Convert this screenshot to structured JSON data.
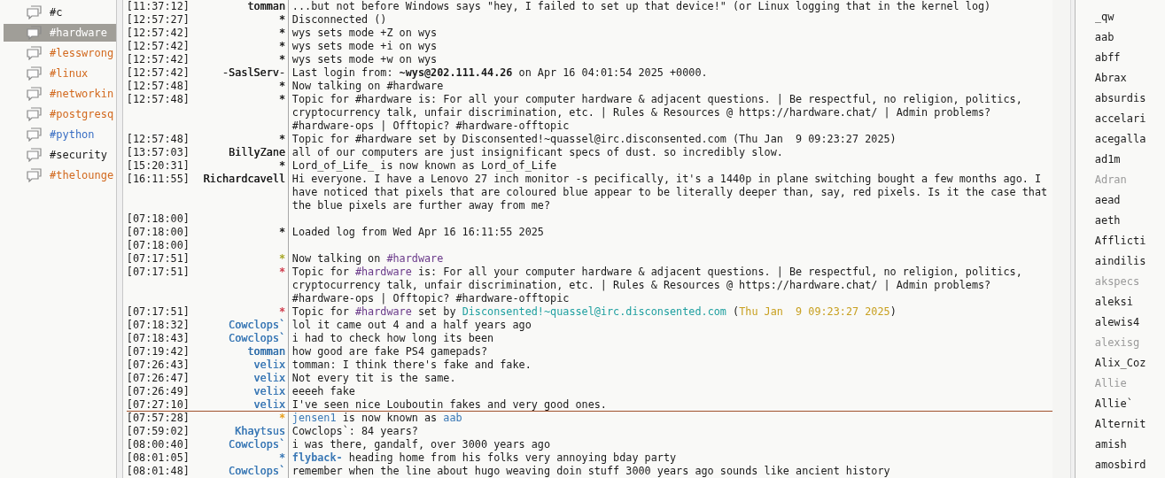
{
  "channels": [
    {
      "label": "#c",
      "color": "#1a1a1a",
      "selected": false
    },
    {
      "label": "#hardware",
      "color": "#ffffff",
      "selected": true
    },
    {
      "label": "#lesswrong",
      "color": "#d2691e",
      "selected": false
    },
    {
      "label": "#linux",
      "color": "#d2691e",
      "selected": false
    },
    {
      "label": "#networkin",
      "color": "#d2691e",
      "selected": false
    },
    {
      "label": "#postgresq",
      "color": "#d2691e",
      "selected": false
    },
    {
      "label": "#python",
      "color": "#3a6fc4",
      "selected": false
    },
    {
      "label": "#security",
      "color": "#1a1a1a",
      "selected": false
    },
    {
      "label": "#thelounge",
      "color": "#d2691e",
      "selected": false
    }
  ],
  "messages": [
    {
      "time": "[11:37:12]",
      "nick": "tomman",
      "color": "#1a1a1a",
      "marker": false,
      "segments": [
        {
          "kind": "plain",
          "text": "...but not before Windows says \"hey, I failed to set up that device!\" (or Linux logging that in the kernel log)"
        }
      ]
    },
    {
      "time": "[12:57:27]",
      "nick": "*",
      "color": "#1a1a1a",
      "marker": false,
      "segments": [
        {
          "kind": "plain",
          "text": "Disconnected ()"
        }
      ]
    },
    {
      "time": "[12:57:42]",
      "nick": "*",
      "color": "#1a1a1a",
      "marker": false,
      "segments": [
        {
          "kind": "plain",
          "text": "wys sets mode +Z on wys"
        }
      ]
    },
    {
      "time": "[12:57:42]",
      "nick": "*",
      "color": "#1a1a1a",
      "marker": false,
      "segments": [
        {
          "kind": "plain",
          "text": "wys sets mode +i on wys"
        }
      ]
    },
    {
      "time": "[12:57:42]",
      "nick": "*",
      "color": "#1a1a1a",
      "marker": false,
      "segments": [
        {
          "kind": "plain",
          "text": "wys sets mode +w on wys"
        }
      ]
    },
    {
      "time": "[12:57:42]",
      "nick": "-SaslServ-",
      "color": "#1a1a1a",
      "marker": false,
      "segments": [
        {
          "kind": "plain",
          "text": "Last login from: "
        },
        {
          "kind": "bold",
          "text": "~wys@202.111.44.26"
        },
        {
          "kind": "plain",
          "text": " on Apr 16 04:01:54 2025 +0000."
        }
      ]
    },
    {
      "time": "[12:57:48]",
      "nick": "*",
      "color": "#1a1a1a",
      "marker": false,
      "segments": [
        {
          "kind": "plain",
          "text": "Now talking on #hardware"
        }
      ]
    },
    {
      "time": "[12:57:48]",
      "nick": "*",
      "color": "#1a1a1a",
      "marker": false,
      "segments": [
        {
          "kind": "plain",
          "text": "Topic for #hardware is: For all your computer hardware & adjacent questions. | Be respectful, no religion, politics, cryptocurrency talk, unfair discrimination, etc. | Rules & Resources @ https://hardware.chat/ | Admin problems? #hardware-ops | Offtopic? #hardware-offtopic"
        }
      ]
    },
    {
      "time": "[12:57:48]",
      "nick": "*",
      "color": "#1a1a1a",
      "marker": false,
      "segments": [
        {
          "kind": "plain",
          "text": "Topic for #hardware set by Disconsented!~quassel@irc.disconsented.com (Thu Jan  9 09:23:27 2025)"
        }
      ]
    },
    {
      "time": "[13:57:03]",
      "nick": "BillyZane",
      "color": "#1a1a1a",
      "marker": false,
      "segments": [
        {
          "kind": "plain",
          "text": "all of our computers are just insignificant specs of dust. so incredibly slow."
        }
      ]
    },
    {
      "time": "[15:20:31]",
      "nick": "*",
      "color": "#1a1a1a",
      "marker": false,
      "segments": [
        {
          "kind": "plain",
          "text": "Lord_of_Life_ is now known as Lord_of_Life"
        }
      ]
    },
    {
      "time": "[16:11:55]",
      "nick": "Richardcavell",
      "color": "#1a1a1a",
      "marker": false,
      "segments": [
        {
          "kind": "plain",
          "text": "Hi everyone. I have a Lenovo 27 inch monitor -s pecifically, it's a 1440p in plane switching bought a few months ago. I have noticed that pixels that are coloured blue appear to be literally deeper than, say, red pixels. Is it the case that the blue pixels are further away from me?"
        }
      ]
    },
    {
      "time": "[07:18:00]",
      "marker": false
    },
    {
      "time": "[07:18:00]",
      "nick": "*",
      "color": "#1a1a1a",
      "marker": false,
      "segments": [
        {
          "kind": "plain",
          "text": "Loaded log from Wed Apr 16 16:11:55 2025"
        }
      ]
    },
    {
      "time": "[07:18:00]",
      "marker": false
    },
    {
      "time": "[07:17:51]",
      "nick": "*",
      "color": "#a8a82a",
      "marker": false,
      "segments": [
        {
          "kind": "plain",
          "text": "Now talking on "
        },
        {
          "kind": "channel",
          "text": "#hardware"
        }
      ]
    },
    {
      "time": "[07:17:51]",
      "nick": "*",
      "color": "#d04050",
      "marker": false,
      "segments": [
        {
          "kind": "plain",
          "text": "Topic for "
        },
        {
          "kind": "channel",
          "text": "#hardware"
        },
        {
          "kind": "plain",
          "text": " is: For all your computer hardware & adjacent questions. | Be respectful, no religion, politics, cryptocurrency talk, unfair discrimination, etc. | Rules & Resources @ https://hardware.chat/ | Admin problems? #hardware-ops | Offtopic? #hardware-offtopic"
        }
      ]
    },
    {
      "time": "[07:17:51]",
      "nick": "*",
      "color": "#d04050",
      "marker": false,
      "segments": [
        {
          "kind": "plain",
          "text": "Topic for "
        },
        {
          "kind": "channel",
          "text": "#hardware"
        },
        {
          "kind": "plain",
          "text": " set by "
        },
        {
          "kind": "host",
          "text": "Disconsented!~quassel@irc.disconsented.com"
        },
        {
          "kind": "plain",
          "text": " ("
        },
        {
          "kind": "date",
          "text": "Thu Jan  9 09:23:27 2025"
        },
        {
          "kind": "plain",
          "text": ")"
        }
      ]
    },
    {
      "time": "[07:18:32]",
      "nick": "Cowclops`",
      "color": "#3a78b5",
      "marker": false,
      "segments": [
        {
          "kind": "plain",
          "text": "lol it came out 4 and a half years ago"
        }
      ]
    },
    {
      "time": "[07:18:43]",
      "nick": "Cowclops`",
      "color": "#3a78b5",
      "marker": false,
      "segments": [
        {
          "kind": "plain",
          "text": "i had to check how long its been"
        }
      ]
    },
    {
      "time": "[07:19:42]",
      "nick": "tomman",
      "color": "#2a6aa8",
      "marker": false,
      "segments": [
        {
          "kind": "plain",
          "text": "how good are fake PS4 gamepads?"
        }
      ]
    },
    {
      "time": "[07:26:43]",
      "nick": "velix",
      "color": "#3a78b5",
      "marker": false,
      "segments": [
        {
          "kind": "plain",
          "text": "tomman: I think there's fake and fake."
        }
      ]
    },
    {
      "time": "[07:26:47]",
      "nick": "velix",
      "color": "#3a78b5",
      "marker": false,
      "segments": [
        {
          "kind": "plain",
          "text": "Not every tit is the same."
        }
      ]
    },
    {
      "time": "[07:26:49]",
      "nick": "velix",
      "color": "#3a78b5",
      "marker": false,
      "segments": [
        {
          "kind": "plain",
          "text": "eeeeh fake"
        }
      ]
    },
    {
      "time": "[07:27:10]",
      "nick": "velix",
      "color": "#3a78b5",
      "marker": true,
      "segments": [
        {
          "kind": "plain",
          "text": "I've seen nice Louboutin fakes and very good ones."
        }
      ]
    },
    {
      "time": "[07:57:28]",
      "nick": "*",
      "color": "#e8a020",
      "marker": false,
      "segments": [
        {
          "kind": "nick",
          "text": "jensen1"
        },
        {
          "kind": "plain",
          "text": " is now known as "
        },
        {
          "kind": "nick",
          "text": "aab"
        }
      ]
    },
    {
      "time": "[07:59:02]",
      "nick": "Khaytsus",
      "color": "#3a78b5",
      "marker": false,
      "segments": [
        {
          "kind": "plain",
          "text": "Cowclops`: 84 years?"
        }
      ]
    },
    {
      "time": "[08:00:40]",
      "nick": "Cowclops`",
      "color": "#3a78b5",
      "marker": false,
      "segments": [
        {
          "kind": "plain",
          "text": "i was there, gandalf, over 3000 years ago"
        }
      ]
    },
    {
      "time": "[08:01:05]",
      "nick": "*",
      "color": "#3a78b5",
      "marker": false,
      "segments": [
        {
          "kind": "nickbold",
          "text": "flyback-"
        },
        {
          "kind": "plain",
          "text": " heading home from his folks very annoying bday party"
        }
      ]
    },
    {
      "time": "[08:01:48]",
      "nick": "Cowclops`",
      "color": "#3a78b5",
      "marker": false,
      "segments": [
        {
          "kind": "plain",
          "text": "remember when the line about hugo weaving doin stuff 3000 years ago sounds like ancient history"
        }
      ]
    }
  ],
  "users": [
    {
      "name": "_qw",
      "away": false
    },
    {
      "name": "aab",
      "away": false
    },
    {
      "name": "abff",
      "away": false
    },
    {
      "name": "Abrax",
      "away": false
    },
    {
      "name": "absurdis",
      "away": false
    },
    {
      "name": "accelari",
      "away": false
    },
    {
      "name": "acegalla",
      "away": false
    },
    {
      "name": "ad1m",
      "away": false
    },
    {
      "name": "Adran",
      "away": true
    },
    {
      "name": "aead",
      "away": false
    },
    {
      "name": "aeth",
      "away": false
    },
    {
      "name": "Afflicti",
      "away": false
    },
    {
      "name": "aindilis",
      "away": false
    },
    {
      "name": "akspecs",
      "away": true
    },
    {
      "name": "aleksi",
      "away": false
    },
    {
      "name": "alewis4",
      "away": false
    },
    {
      "name": "alexisg",
      "away": true
    },
    {
      "name": "Alix_Coz",
      "away": false
    },
    {
      "name": "Allie",
      "away": true
    },
    {
      "name": "Allie`",
      "away": false
    },
    {
      "name": "Alternit",
      "away": false
    },
    {
      "name": "amish",
      "away": false
    },
    {
      "name": "amosbird",
      "away": false
    }
  ]
}
